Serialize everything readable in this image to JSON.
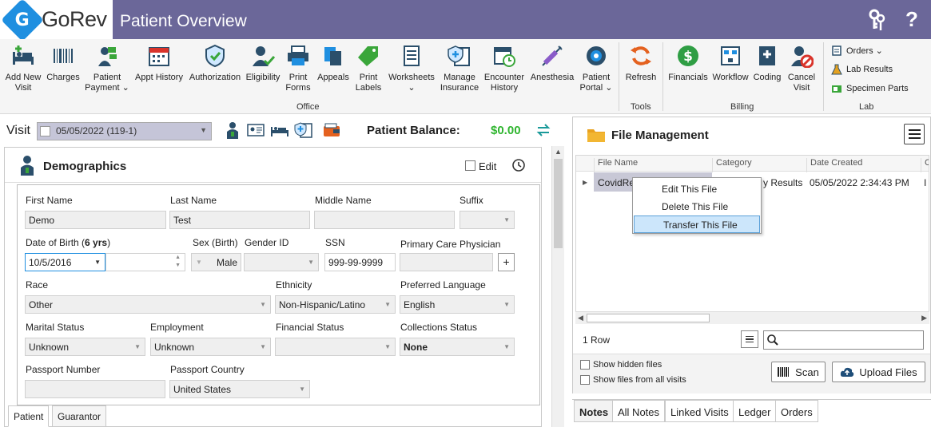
{
  "header": {
    "logo_text": "GoRev",
    "logo_mark": "G",
    "page_title": "Patient Overview",
    "help": "?"
  },
  "toolbar": {
    "items": [
      {
        "label1": "Add New",
        "label2": "Visit",
        "icon": "bed-plus-icon"
      },
      {
        "label1": "Charges",
        "label2": "",
        "icon": "barcode-icon"
      },
      {
        "label1": "Patient",
        "label2": "Payment ⌄",
        "icon": "payment-icon"
      },
      {
        "label1": "Appt History",
        "label2": "",
        "icon": "calendar-icon"
      },
      {
        "label1": "Authorization",
        "label2": "",
        "icon": "shield-check-icon"
      },
      {
        "label1": "Eligibility",
        "label2": "",
        "icon": "user-check-icon"
      },
      {
        "label1": "Print",
        "label2": "Forms",
        "icon": "printer-icon"
      },
      {
        "label1": "Appeals",
        "label2": "",
        "icon": "documents-icon"
      },
      {
        "label1": "Print",
        "label2": "Labels",
        "icon": "tag-icon"
      },
      {
        "label1": "Worksheets",
        "label2": "⌄",
        "icon": "worksheet-icon"
      },
      {
        "label1": "Manage",
        "label2": "Insurance",
        "icon": "insurance-icon"
      },
      {
        "label1": "Encounter",
        "label2": "History",
        "icon": "calendar-clock-icon"
      },
      {
        "label1": "Anesthesia",
        "label2": "",
        "icon": "syringe-icon"
      },
      {
        "label1": "Patient",
        "label2": "Portal ⌄",
        "icon": "globe-gear-icon"
      },
      {
        "label1": "Refresh",
        "label2": "",
        "icon": "refresh-icon"
      },
      {
        "label1": "Financials",
        "label2": "",
        "icon": "dollar-icon"
      },
      {
        "label1": "Workflow",
        "label2": "",
        "icon": "workflow-icon"
      },
      {
        "label1": "Coding",
        "label2": "",
        "icon": "book-plus-icon"
      },
      {
        "label1": "Cancel",
        "label2": "Visit",
        "icon": "cancel-visit-icon"
      }
    ],
    "groups": {
      "office": "Office",
      "tools": "Tools",
      "billing": "Billing",
      "lab": "Lab"
    },
    "lab_items": {
      "orders": "Orders ⌄",
      "lab_results": "Lab Results",
      "specimen_parts": "Specimen Parts"
    }
  },
  "visit": {
    "label": "Visit",
    "value": "05/05/2022 (119-1)",
    "balance_label": "Patient Balance:",
    "balance_value": "$0.00"
  },
  "demographics": {
    "title": "Demographics",
    "edit_label": "Edit",
    "fields": {
      "first_name_label": "First Name",
      "first_name": "Demo",
      "last_name_label": "Last Name",
      "last_name": "Test",
      "middle_name_label": "Middle Name",
      "middle_name": "",
      "suffix_label": "Suffix",
      "suffix": "",
      "dob_label_pre": "Date of Birth (",
      "dob_age": "6 yrs",
      "dob_label_post": ")",
      "dob": "10/5/2016",
      "sex_label": "Sex (Birth)",
      "sex": "Male",
      "gender_label": "Gender ID",
      "gender": "",
      "ssn_label": "SSN",
      "ssn": "999-99-9999",
      "pcp_label": "Primary Care Physician",
      "pcp": "",
      "pcp_add": "+",
      "race_label": "Race",
      "race": "Other",
      "ethnicity_label": "Ethnicity",
      "ethnicity": "Non-Hispanic/Latino",
      "language_label": "Preferred Language",
      "language": "English",
      "marital_label": "Marital Status",
      "marital": "Unknown",
      "employment_label": "Employment",
      "employment": "Unknown",
      "financial_label": "Financial Status",
      "financial": "",
      "collections_label": "Collections Status",
      "collections": "None",
      "passport_label": "Passport Number",
      "passport": "",
      "country_label": "Passport Country",
      "country": "United States"
    },
    "tabs": [
      "Patient",
      "Guarantor"
    ]
  },
  "file_management": {
    "title": "File Management",
    "columns": [
      "File Name",
      "Category",
      "Date Created",
      "C"
    ],
    "row": {
      "file_name": "CovidRe",
      "category": "y Results",
      "date_created": "05/05/2022 2:34:43 PM",
      "extra": "I"
    },
    "row_count": "1 Row",
    "show_hidden": "Show hidden files",
    "show_all_visits": "Show files from all visits",
    "scan": "Scan",
    "upload": "Upload Files"
  },
  "context_menu": {
    "items": [
      "Edit This File",
      "Delete This File",
      "Transfer This File"
    ],
    "highlighted": 2
  },
  "bottom_tabs": [
    "Notes",
    "All Notes",
    "Linked Visits",
    "Ledger",
    "Orders"
  ],
  "colors": {
    "header": "#6b6799",
    "balance": "#2fb52f",
    "accent": "#1f8fe0"
  }
}
